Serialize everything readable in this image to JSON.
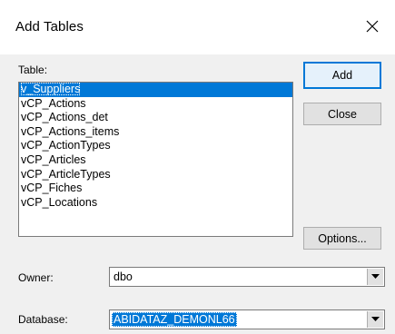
{
  "window": {
    "title": "Add Tables",
    "close_glyph": "×"
  },
  "table_section": {
    "label": "Table:",
    "items": [
      "v_Suppliers",
      "vCP_Actions",
      "vCP_Actions_det",
      "vCP_Actions_items",
      "vCP_ActionTypes",
      "vCP_Articles",
      "vCP_ArticleTypes",
      "vCP_Fiches",
      "vCP_Locations"
    ],
    "selected_index": 0
  },
  "buttons": {
    "add": "Add",
    "close": "Close",
    "options": "Options..."
  },
  "owner": {
    "label": "Owner:",
    "value": "dbo"
  },
  "database": {
    "label": "Database:",
    "value": "ABIDATAZ_DEMONL66"
  },
  "colors": {
    "selection": "#0078d7",
    "client_bg": "#f0f0f0"
  },
  "icons": {
    "close": "close-icon",
    "dropdown": "chevron-down-icon"
  }
}
